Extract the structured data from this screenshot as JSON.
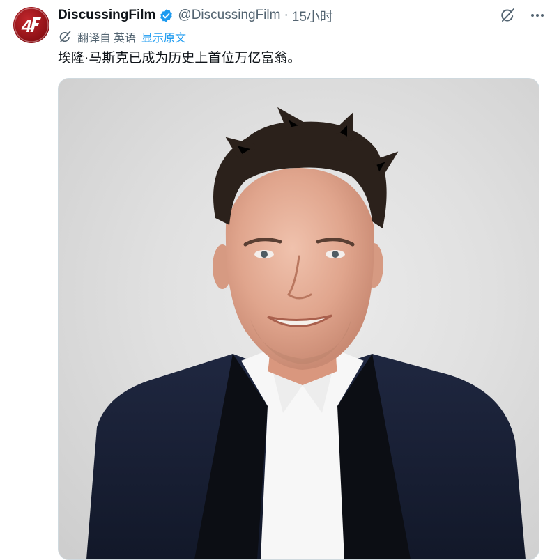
{
  "tweet": {
    "author": {
      "display_name": "DiscussingFilm",
      "handle": "@DiscussingFilm",
      "avatar_icon": "discussingfilm-logo",
      "verified_icon": "verified-badge-icon",
      "verified_color": "#1d9bf0"
    },
    "separator": "·",
    "time": "15小时",
    "actions": {
      "grok_icon": "grok-icon",
      "more_icon": "more-icon"
    },
    "translation": {
      "icon": "translate-icon",
      "prefix": "翻译自",
      "language": "英语",
      "show_original": "显示原文",
      "link_color": "#1d9bf0"
    },
    "text": "埃隆·马斯克已成为历史上首位万亿富翁。",
    "media": {
      "type": "photo",
      "subject": "portrait-photo"
    }
  }
}
